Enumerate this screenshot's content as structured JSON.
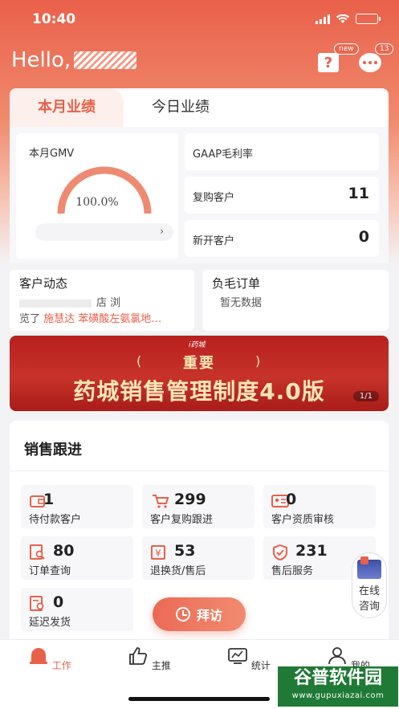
{
  "status_bar": {
    "time": "10:40"
  },
  "header": {
    "greeting": "Hello,",
    "help_badge": "new",
    "message_badge": "13"
  },
  "performance": {
    "tabs": [
      {
        "label": "本月业绩",
        "active": true
      },
      {
        "label": "今日业绩",
        "active": false
      }
    ],
    "gmv": {
      "label": "本月GMV",
      "percent_text": "100.0%",
      "progress": 1.0
    },
    "stats": [
      {
        "label": "GAAP毛利率",
        "value": ""
      },
      {
        "label": "复购客户",
        "value": "11"
      },
      {
        "label": "新开客户",
        "value": "0"
      }
    ]
  },
  "customer_dynamics": {
    "title": "客户动态",
    "line1_suffix": "店 浏",
    "line2_prefix": "览了 ",
    "line2_name": "施慧达 苯磺酸左氨氯地…"
  },
  "negative_orders": {
    "title": "负毛订单",
    "empty_text": "暂无数据"
  },
  "banner": {
    "brand": "i药城",
    "subtitle": "重要",
    "title": "药城销售管理制度4.0版",
    "page": "1/1"
  },
  "sales_followup": {
    "title": "销售跟进",
    "tiles": [
      {
        "num": "1",
        "label": "待付款客户",
        "icon": "wallet-icon"
      },
      {
        "num": "299",
        "label": "客户复购跟进",
        "icon": "cart-icon"
      },
      {
        "num": "0",
        "label": "客户资质审核",
        "icon": "id-card-icon"
      },
      {
        "num": "80",
        "label": "订单查询",
        "icon": "order-search-icon"
      },
      {
        "num": "53",
        "label": "退换货/售后",
        "icon": "yen-return-icon"
      },
      {
        "num": "231",
        "label": "售后服务",
        "icon": "shield-check-icon"
      },
      {
        "num": "0",
        "label": "延迟发货",
        "icon": "delay-doc-icon"
      }
    ],
    "visit_button": "拜访"
  },
  "consult": {
    "line1": "在线",
    "line2": "咨询"
  },
  "tabbar": [
    {
      "label": "工作",
      "icon": "bell-work-icon",
      "active": true
    },
    {
      "label": "主推",
      "icon": "thumbs-up-icon",
      "active": false
    },
    {
      "label": "统计",
      "icon": "chart-monitor-icon",
      "active": false
    },
    {
      "label": "我的",
      "icon": "user-icon",
      "active": false
    }
  ],
  "watermark": {
    "title": "谷普软件园",
    "url": "www.gupuxiazai.com"
  },
  "colors": {
    "accent": "#e9604a",
    "banner_red": "#b8201d",
    "banner_gold": "#fbe6b5"
  }
}
